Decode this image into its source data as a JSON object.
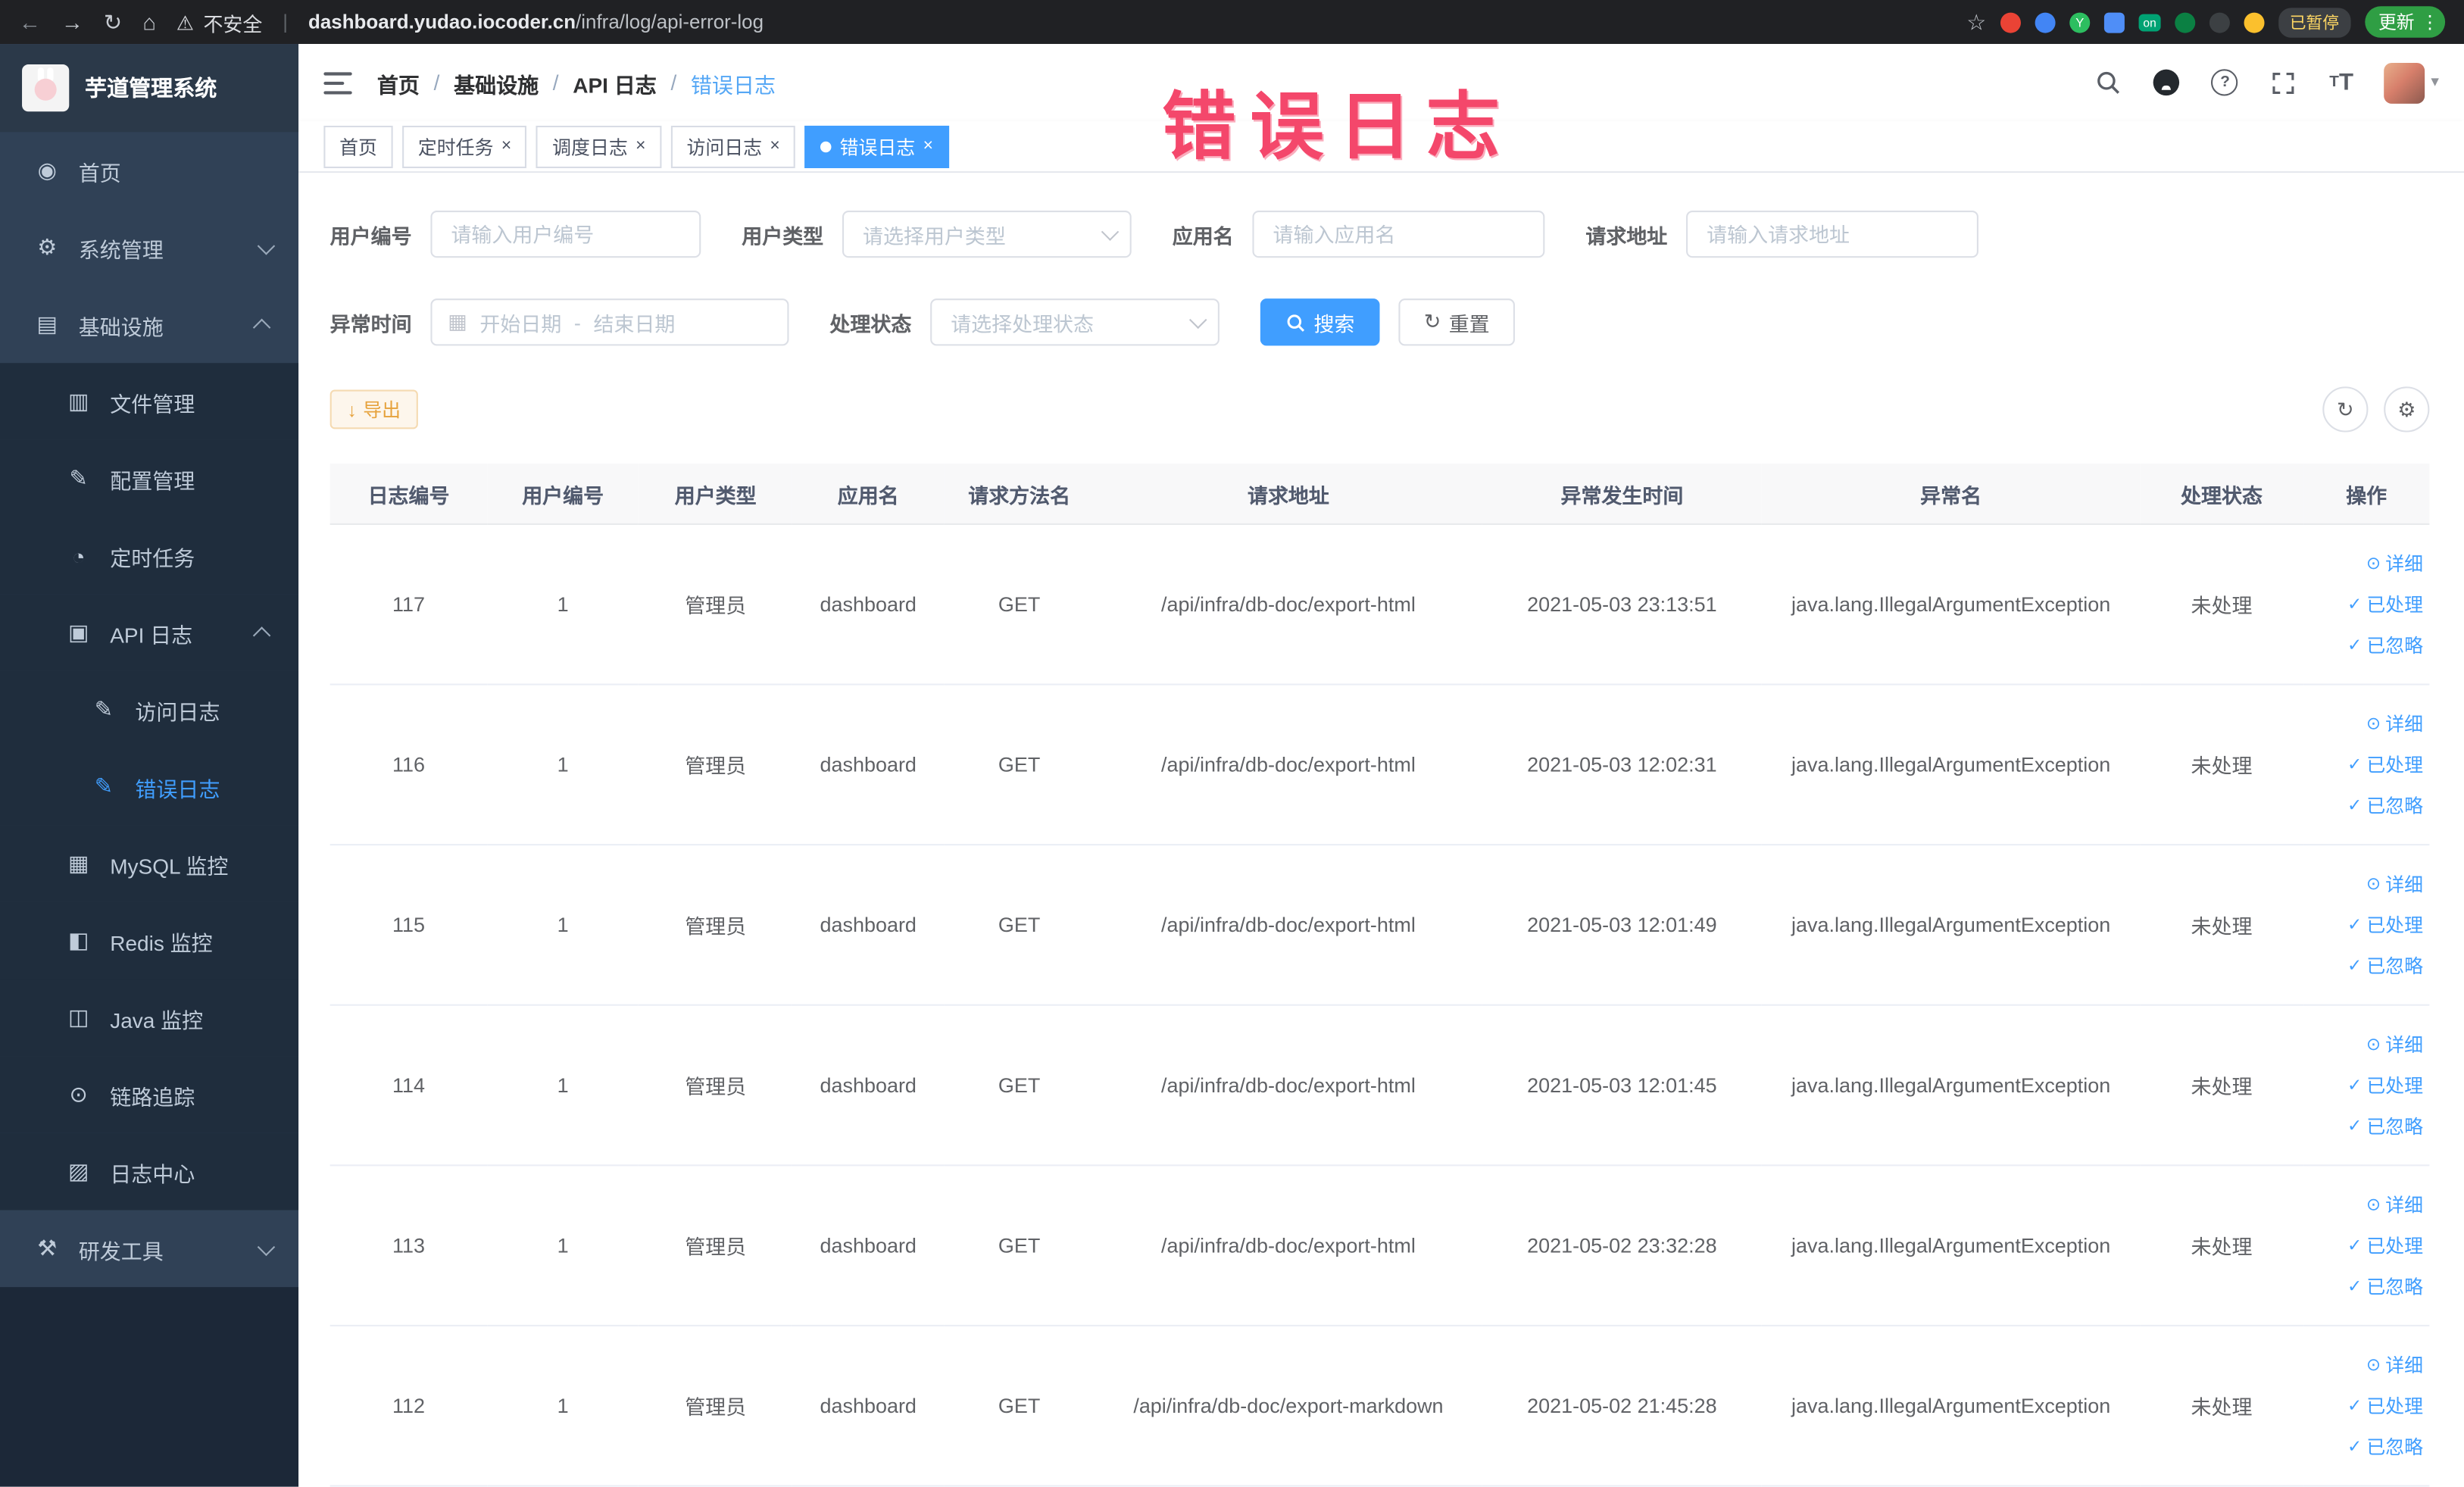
{
  "browser": {
    "security_label": "不安全",
    "url_domain": "dashboard.yudao.iocoder.cn",
    "url_path": "/infra/log/api-error-log",
    "extension_on_badge": "on",
    "extension_y_badge": "Y",
    "paused_badge": "已暂停",
    "update_button": "更新"
  },
  "watermark": "错误日志",
  "sidebar": {
    "logo_title": "芋道管理系统",
    "items": [
      {
        "label": "首页",
        "level": "top"
      },
      {
        "label": "系统管理",
        "level": "top",
        "chevron": "down"
      },
      {
        "label": "基础设施",
        "level": "top",
        "chevron": "up"
      },
      {
        "label": "文件管理",
        "level": "sub"
      },
      {
        "label": "配置管理",
        "level": "sub"
      },
      {
        "label": "定时任务",
        "level": "sub"
      },
      {
        "label": "API 日志",
        "level": "sub",
        "chevron": "up"
      },
      {
        "label": "访问日志",
        "level": "subsub"
      },
      {
        "label": "错误日志",
        "level": "subsub",
        "active": true
      },
      {
        "label": "MySQL 监控",
        "level": "sub"
      },
      {
        "label": "Redis 监控",
        "level": "sub"
      },
      {
        "label": "Java 监控",
        "level": "sub"
      },
      {
        "label": "链路追踪",
        "level": "sub"
      },
      {
        "label": "日志中心",
        "level": "sub"
      },
      {
        "label": "研发工具",
        "level": "top",
        "chevron": "down"
      }
    ]
  },
  "navbar": {
    "breadcrumb": [
      "首页",
      "基础设施",
      "API 日志",
      "错误日志"
    ]
  },
  "tags": [
    {
      "label": "首页",
      "active": false,
      "closable": false
    },
    {
      "label": "定时任务",
      "active": false,
      "closable": true
    },
    {
      "label": "调度日志",
      "active": false,
      "closable": true
    },
    {
      "label": "访问日志",
      "active": false,
      "closable": true
    },
    {
      "label": "错误日志",
      "active": true,
      "closable": true
    }
  ],
  "filters": {
    "user_id_label": "用户编号",
    "user_id_placeholder": "请输入用户编号",
    "user_type_label": "用户类型",
    "user_type_placeholder": "请选择用户类型",
    "app_name_label": "应用名",
    "app_name_placeholder": "请输入应用名",
    "request_url_label": "请求地址",
    "request_url_placeholder": "请输入请求地址",
    "exception_time_label": "异常时间",
    "date_start_placeholder": "开始日期",
    "date_separator": "-",
    "date_end_placeholder": "结束日期",
    "process_status_label": "处理状态",
    "process_status_placeholder": "请选择处理状态",
    "search_button": "搜索",
    "reset_button": "重置"
  },
  "toolbar": {
    "export_button": "导出"
  },
  "table": {
    "columns": [
      "日志编号",
      "用户编号",
      "用户类型",
      "应用名",
      "请求方法名",
      "请求地址",
      "异常发生时间",
      "异常名",
      "处理状态",
      "操作"
    ],
    "ops": [
      "详细",
      "已处理",
      "已忽略"
    ],
    "rows": [
      {
        "id": "117",
        "user_id": "1",
        "user_type": "管理员",
        "app": "dashboard",
        "method": "GET",
        "url": "/api/infra/db-doc/export-html",
        "time": "2021-05-03 23:13:51",
        "exception": "java.lang.IllegalArgumentException",
        "status": "未处理"
      },
      {
        "id": "116",
        "user_id": "1",
        "user_type": "管理员",
        "app": "dashboard",
        "method": "GET",
        "url": "/api/infra/db-doc/export-html",
        "time": "2021-05-03 12:02:31",
        "exception": "java.lang.IllegalArgumentException",
        "status": "未处理"
      },
      {
        "id": "115",
        "user_id": "1",
        "user_type": "管理员",
        "app": "dashboard",
        "method": "GET",
        "url": "/api/infra/db-doc/export-html",
        "time": "2021-05-03 12:01:49",
        "exception": "java.lang.IllegalArgumentException",
        "status": "未处理"
      },
      {
        "id": "114",
        "user_id": "1",
        "user_type": "管理员",
        "app": "dashboard",
        "method": "GET",
        "url": "/api/infra/db-doc/export-html",
        "time": "2021-05-03 12:01:45",
        "exception": "java.lang.IllegalArgumentException",
        "status": "未处理"
      },
      {
        "id": "113",
        "user_id": "1",
        "user_type": "管理员",
        "app": "dashboard",
        "method": "GET",
        "url": "/api/infra/db-doc/export-html",
        "time": "2021-05-02 23:32:28",
        "exception": "java.lang.IllegalArgumentException",
        "status": "未处理"
      },
      {
        "id": "112",
        "user_id": "1",
        "user_type": "管理员",
        "app": "dashboard",
        "method": "GET",
        "url": "/api/infra/db-doc/export-markdown",
        "time": "2021-05-02 21:45:28",
        "exception": "java.lang.IllegalArgumentException",
        "status": "未处理"
      }
    ]
  },
  "colors": {
    "accent": "#409eff",
    "warning": "#e6a23c",
    "sidebar_bg": "#304156",
    "submenu_bg": "#1f2d3d",
    "watermark": "#f4476b"
  }
}
